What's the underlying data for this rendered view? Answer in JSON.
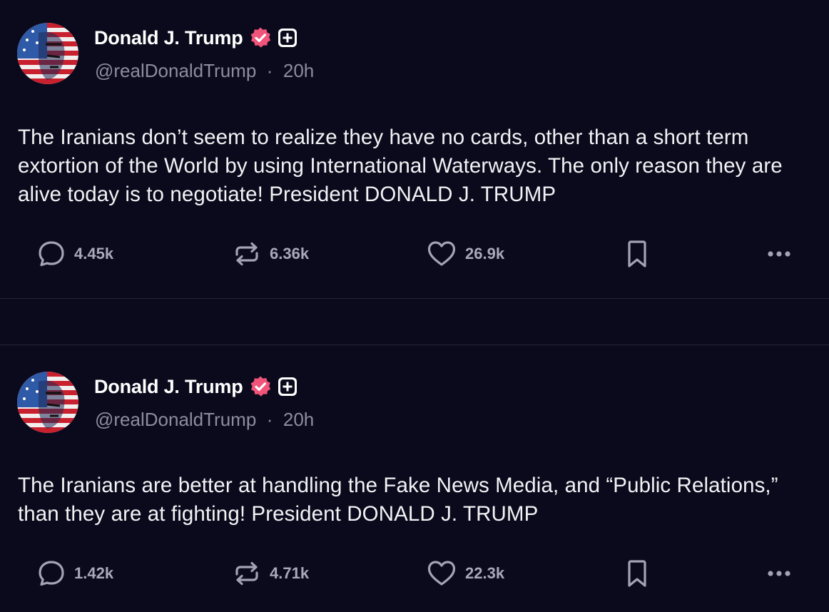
{
  "posts": [
    {
      "author": {
        "name": "Donald J. Trump",
        "handle": "@realDonaldTrump",
        "separator": "·",
        "time": "20h"
      },
      "text": "The Iranians don’t seem to realize they have no cards, other than a short term extortion of the World by using International Waterways. The only reason they are alive today is to negotiate! President DONALD J. TRUMP",
      "stats": {
        "replies": "4.45k",
        "reposts": "6.36k",
        "likes": "26.9k"
      }
    },
    {
      "author": {
        "name": "Donald J. Trump",
        "handle": "@realDonaldTrump",
        "separator": "·",
        "time": "20h"
      },
      "text": "The Iranians are better at handling the Fake News Media, and “Public Relations,” than they are at fighting! President DONALD J. TRUMP",
      "stats": {
        "replies": "1.42k",
        "reposts": "4.71k",
        "likes": "22.3k"
      }
    }
  ],
  "icons": {
    "verified": "verified-badge-icon",
    "plus": "plus-badge-icon",
    "reply": "speech-bubble-icon",
    "repost": "repost-arrows-icon",
    "like": "heart-icon",
    "bookmark": "bookmark-icon",
    "more": "ellipsis-icon"
  },
  "colors": {
    "background": "#0b0a1c",
    "verified": "#f0547a",
    "muted_text": "#8d8ca0",
    "icon": "#a4a3b6"
  }
}
